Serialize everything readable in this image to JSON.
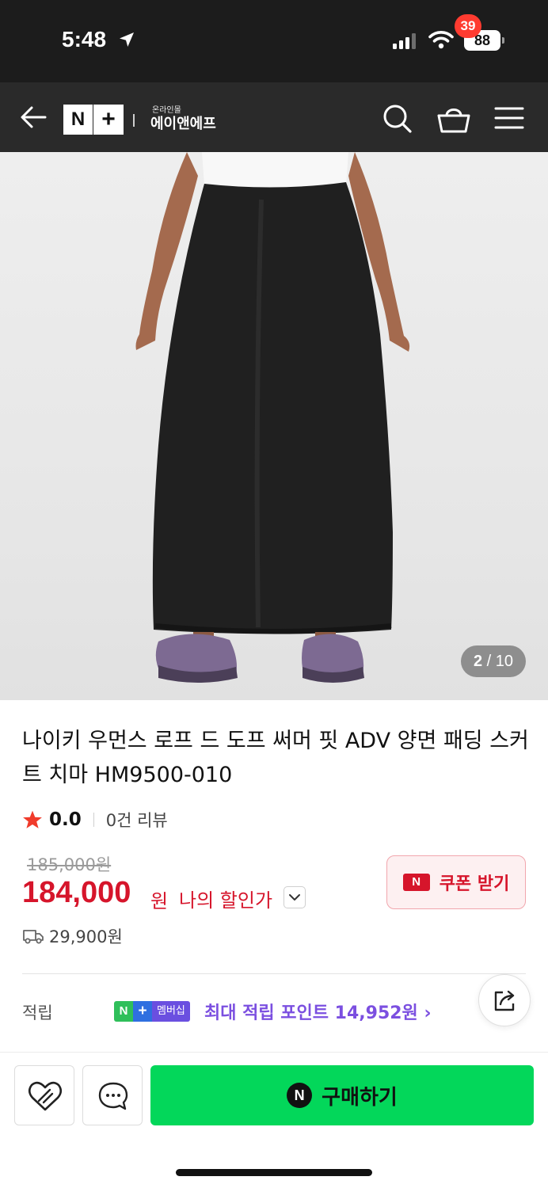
{
  "status_bar": {
    "time": "5:48",
    "battery": "88",
    "icons": [
      "location-arrow-icon",
      "cellular-signal-icon",
      "wifi-icon",
      "battery-icon"
    ]
  },
  "nav": {
    "logo_n": "N",
    "logo_plus": "+",
    "mall_sub": "온라인몰",
    "mall_name": "에이앤에프",
    "cart_count": "39",
    "icons": [
      "back-arrow-icon",
      "search-icon",
      "shopping-basket-icon",
      "hamburger-menu-icon"
    ]
  },
  "gallery": {
    "current": "2",
    "separator": "/",
    "total": "10"
  },
  "product": {
    "title": "나이키 우먼스 로프 드 도프 써머 핏 ADV 양면 패딩 스커트 치마 HM9500-010",
    "rating": "0.0",
    "review_count": "0건 리뷰",
    "original_price": "185,000원",
    "sale_price": "184,000",
    "sale_unit": "원",
    "my_discount_label": "나의 할인가",
    "coupon_icon": "N",
    "coupon_label": "쿠폰 받기",
    "shipping_fee": "29,900원"
  },
  "points": {
    "label": "적립",
    "badge_n": "N",
    "badge_plus": "+",
    "badge_text": "멤버십",
    "text": "최대 적립 포인트 14,952원 ›"
  },
  "bottom_bar": {
    "buy_icon": "N",
    "buy_label": "구매하기"
  },
  "colors": {
    "sale_red": "#d6152b",
    "buy_green": "#03d75a",
    "points_purple": "#7b4fe0",
    "nav_dark": "#2a2a2a"
  }
}
